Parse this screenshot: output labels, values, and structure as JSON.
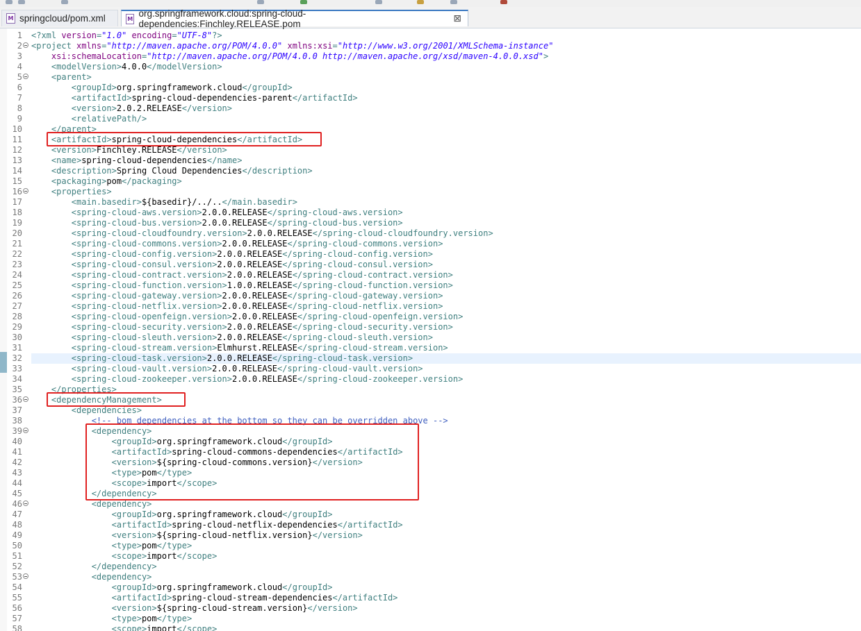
{
  "tabs": [
    {
      "label": "springcloud/pom.xml",
      "icon": "xml-file-icon",
      "active": false
    },
    {
      "label": "org.springframework.cloud:spring-cloud-dependencies:Finchley.RELEASE.pom",
      "icon": "xml-file-icon",
      "active": true,
      "close": "⊠"
    }
  ],
  "editor": {
    "current_line": 32,
    "folded_lines": [
      2,
      5,
      16,
      36,
      39,
      46,
      53
    ],
    "lines": [
      {
        "n": "1",
        "segs": [
          [
            "pi",
            "<?xml "
          ],
          [
            "attr",
            "version"
          ],
          [
            "pi",
            "="
          ],
          [
            "aval",
            "\"1.0\""
          ],
          [
            "pi",
            " "
          ],
          [
            "attr",
            "encoding"
          ],
          [
            "pi",
            "="
          ],
          [
            "aval",
            "\"UTF-8\""
          ],
          [
            "pi",
            "?>"
          ]
        ]
      },
      {
        "n": "2",
        "segs": [
          [
            "tag",
            "<project "
          ],
          [
            "attr",
            "xmlns"
          ],
          [
            "tag",
            "="
          ],
          [
            "aval",
            "\"http://maven.apache.org/POM/4.0.0\""
          ],
          [
            "tag",
            " "
          ],
          [
            "attr",
            "xmlns:xsi"
          ],
          [
            "tag",
            "="
          ],
          [
            "aval",
            "\"http://www.w3.org/2001/XMLSchema-instance\""
          ]
        ]
      },
      {
        "n": "3",
        "segs": [
          [
            "tag",
            "    "
          ],
          [
            "attr",
            "xsi:schemaLocation"
          ],
          [
            "tag",
            "="
          ],
          [
            "aval",
            "\"http://maven.apache.org/POM/4.0.0 http://maven.apache.org/xsd/maven-4.0.0.xsd\""
          ],
          [
            "tag",
            ">"
          ]
        ]
      },
      {
        "n": "4",
        "segs": [
          [
            "tag",
            "    <modelVersion>"
          ],
          [
            "txt",
            "4.0.0"
          ],
          [
            "tag",
            "</modelVersion>"
          ]
        ]
      },
      {
        "n": "5",
        "segs": [
          [
            "tag",
            "    <parent>"
          ]
        ]
      },
      {
        "n": "6",
        "segs": [
          [
            "tag",
            "        <groupId>"
          ],
          [
            "txt",
            "org.springframework.cloud"
          ],
          [
            "tag",
            "</groupId>"
          ]
        ]
      },
      {
        "n": "7",
        "segs": [
          [
            "tag",
            "        <artifactId>"
          ],
          [
            "txt",
            "spring-cloud-dependencies-parent"
          ],
          [
            "tag",
            "</artifactId>"
          ]
        ]
      },
      {
        "n": "8",
        "segs": [
          [
            "tag",
            "        <version>"
          ],
          [
            "txt",
            "2.0.2.RELEASE"
          ],
          [
            "tag",
            "</version>"
          ]
        ]
      },
      {
        "n": "9",
        "segs": [
          [
            "tag",
            "        <relativePath/>"
          ]
        ]
      },
      {
        "n": "10",
        "segs": [
          [
            "tag",
            "    </parent>"
          ]
        ]
      },
      {
        "n": "11",
        "segs": [
          [
            "tag",
            "    <artifactId>"
          ],
          [
            "txt",
            "spring-cloud-dependencies"
          ],
          [
            "tag",
            "</artifactId>"
          ]
        ]
      },
      {
        "n": "12",
        "segs": [
          [
            "tag",
            "    <version>"
          ],
          [
            "txt",
            "Finchley.RELEASE"
          ],
          [
            "tag",
            "</version>"
          ]
        ]
      },
      {
        "n": "13",
        "segs": [
          [
            "tag",
            "    <name>"
          ],
          [
            "txt",
            "spring-cloud-dependencies"
          ],
          [
            "tag",
            "</name>"
          ]
        ]
      },
      {
        "n": "14",
        "segs": [
          [
            "tag",
            "    <description>"
          ],
          [
            "txt",
            "Spring Cloud Dependencies"
          ],
          [
            "tag",
            "</description>"
          ]
        ]
      },
      {
        "n": "15",
        "segs": [
          [
            "tag",
            "    <packaging>"
          ],
          [
            "txt",
            "pom"
          ],
          [
            "tag",
            "</packaging>"
          ]
        ]
      },
      {
        "n": "16",
        "segs": [
          [
            "tag",
            "    <properties>"
          ]
        ]
      },
      {
        "n": "17",
        "segs": [
          [
            "tag",
            "        <main.basedir>"
          ],
          [
            "txt",
            "${basedir}/../.."
          ],
          [
            "tag",
            "</main.basedir>"
          ]
        ]
      },
      {
        "n": "18",
        "segs": [
          [
            "tag",
            "        <spring-cloud-aws.version>"
          ],
          [
            "txt",
            "2.0.0.RELEASE"
          ],
          [
            "tag",
            "</spring-cloud-aws.version>"
          ]
        ]
      },
      {
        "n": "19",
        "segs": [
          [
            "tag",
            "        <spring-cloud-bus.version>"
          ],
          [
            "txt",
            "2.0.0.RELEASE"
          ],
          [
            "tag",
            "</spring-cloud-bus.version>"
          ]
        ]
      },
      {
        "n": "20",
        "segs": [
          [
            "tag",
            "        <spring-cloud-cloudfoundry.version>"
          ],
          [
            "txt",
            "2.0.0.RELEASE"
          ],
          [
            "tag",
            "</spring-cloud-cloudfoundry.version>"
          ]
        ]
      },
      {
        "n": "21",
        "segs": [
          [
            "tag",
            "        <spring-cloud-commons.version>"
          ],
          [
            "txt",
            "2.0.0.RELEASE"
          ],
          [
            "tag",
            "</spring-cloud-commons.version>"
          ]
        ]
      },
      {
        "n": "22",
        "segs": [
          [
            "tag",
            "        <spring-cloud-config.version>"
          ],
          [
            "txt",
            "2.0.0.RELEASE"
          ],
          [
            "tag",
            "</spring-cloud-config.version>"
          ]
        ]
      },
      {
        "n": "23",
        "segs": [
          [
            "tag",
            "        <spring-cloud-consul.version>"
          ],
          [
            "txt",
            "2.0.0.RELEASE"
          ],
          [
            "tag",
            "</spring-cloud-consul.version>"
          ]
        ]
      },
      {
        "n": "24",
        "segs": [
          [
            "tag",
            "        <spring-cloud-contract.version>"
          ],
          [
            "txt",
            "2.0.0.RELEASE"
          ],
          [
            "tag",
            "</spring-cloud-contract.version>"
          ]
        ]
      },
      {
        "n": "25",
        "segs": [
          [
            "tag",
            "        <spring-cloud-function.version>"
          ],
          [
            "txt",
            "1.0.0.RELEASE"
          ],
          [
            "tag",
            "</spring-cloud-function.version>"
          ]
        ]
      },
      {
        "n": "26",
        "segs": [
          [
            "tag",
            "        <spring-cloud-gateway.version>"
          ],
          [
            "txt",
            "2.0.0.RELEASE"
          ],
          [
            "tag",
            "</spring-cloud-gateway.version>"
          ]
        ]
      },
      {
        "n": "27",
        "segs": [
          [
            "tag",
            "        <spring-cloud-netflix.version>"
          ],
          [
            "txt",
            "2.0.0.RELEASE"
          ],
          [
            "tag",
            "</spring-cloud-netflix.version>"
          ]
        ]
      },
      {
        "n": "28",
        "segs": [
          [
            "tag",
            "        <spring-cloud-openfeign.version>"
          ],
          [
            "txt",
            "2.0.0.RELEASE"
          ],
          [
            "tag",
            "</spring-cloud-openfeign.version>"
          ]
        ]
      },
      {
        "n": "29",
        "segs": [
          [
            "tag",
            "        <spring-cloud-security.version>"
          ],
          [
            "txt",
            "2.0.0.RELEASE"
          ],
          [
            "tag",
            "</spring-cloud-security.version>"
          ]
        ]
      },
      {
        "n": "30",
        "segs": [
          [
            "tag",
            "        <spring-cloud-sleuth.version>"
          ],
          [
            "txt",
            "2.0.0.RELEASE"
          ],
          [
            "tag",
            "</spring-cloud-sleuth.version>"
          ]
        ]
      },
      {
        "n": "31",
        "segs": [
          [
            "tag",
            "        <spring-cloud-stream.version>"
          ],
          [
            "txt",
            "Elmhurst.RELEASE"
          ],
          [
            "tag",
            "</spring-cloud-stream.version>"
          ]
        ]
      },
      {
        "n": "32",
        "segs": [
          [
            "tag",
            "        <spring-cloud-task.version>"
          ],
          [
            "txt",
            "2.0.0.RELEASE"
          ],
          [
            "tag",
            "</spring-cloud-task.version>"
          ]
        ]
      },
      {
        "n": "33",
        "segs": [
          [
            "tag",
            "        <spring-cloud-vault.version>"
          ],
          [
            "txt",
            "2.0.0.RELEASE"
          ],
          [
            "tag",
            "</spring-cloud-vault.version>"
          ]
        ]
      },
      {
        "n": "34",
        "segs": [
          [
            "tag",
            "        <spring-cloud-zookeeper.version>"
          ],
          [
            "txt",
            "2.0.0.RELEASE"
          ],
          [
            "tag",
            "</spring-cloud-zookeeper.version>"
          ]
        ]
      },
      {
        "n": "35",
        "segs": [
          [
            "tag",
            "    </properties>"
          ]
        ]
      },
      {
        "n": "36",
        "segs": [
          [
            "tag",
            "    <dependencyManagement>"
          ]
        ]
      },
      {
        "n": "37",
        "segs": [
          [
            "tag",
            "        <dependencies>"
          ]
        ]
      },
      {
        "n": "38",
        "segs": [
          [
            "comment",
            "            <!-- bom dependencies at the bottom so they can be overridden above -->"
          ]
        ]
      },
      {
        "n": "39",
        "segs": [
          [
            "tag",
            "            <dependency>"
          ]
        ]
      },
      {
        "n": "40",
        "segs": [
          [
            "tag",
            "                <groupId>"
          ],
          [
            "txt",
            "org.springframework.cloud"
          ],
          [
            "tag",
            "</groupId>"
          ]
        ]
      },
      {
        "n": "41",
        "segs": [
          [
            "tag",
            "                <artifactId>"
          ],
          [
            "txt",
            "spring-cloud-commons-dependencies"
          ],
          [
            "tag",
            "</artifactId>"
          ]
        ]
      },
      {
        "n": "42",
        "segs": [
          [
            "tag",
            "                <version>"
          ],
          [
            "txt",
            "${spring-cloud-commons.version}"
          ],
          [
            "tag",
            "</version>"
          ]
        ]
      },
      {
        "n": "43",
        "segs": [
          [
            "tag",
            "                <type>"
          ],
          [
            "txt",
            "pom"
          ],
          [
            "tag",
            "</type>"
          ]
        ]
      },
      {
        "n": "44",
        "segs": [
          [
            "tag",
            "                <scope>"
          ],
          [
            "txt",
            "import"
          ],
          [
            "tag",
            "</scope>"
          ]
        ]
      },
      {
        "n": "45",
        "segs": [
          [
            "tag",
            "            </dependency>"
          ]
        ]
      },
      {
        "n": "46",
        "segs": [
          [
            "tag",
            "            <dependency>"
          ]
        ]
      },
      {
        "n": "47",
        "segs": [
          [
            "tag",
            "                <groupId>"
          ],
          [
            "txt",
            "org.springframework.cloud"
          ],
          [
            "tag",
            "</groupId>"
          ]
        ]
      },
      {
        "n": "48",
        "segs": [
          [
            "tag",
            "                <artifactId>"
          ],
          [
            "txt",
            "spring-cloud-netflix-dependencies"
          ],
          [
            "tag",
            "</artifactId>"
          ]
        ]
      },
      {
        "n": "49",
        "segs": [
          [
            "tag",
            "                <version>"
          ],
          [
            "txt",
            "${spring-cloud-netflix.version}"
          ],
          [
            "tag",
            "</version>"
          ]
        ]
      },
      {
        "n": "50",
        "segs": [
          [
            "tag",
            "                <type>"
          ],
          [
            "txt",
            "pom"
          ],
          [
            "tag",
            "</type>"
          ]
        ]
      },
      {
        "n": "51",
        "segs": [
          [
            "tag",
            "                <scope>"
          ],
          [
            "txt",
            "import"
          ],
          [
            "tag",
            "</scope>"
          ]
        ]
      },
      {
        "n": "52",
        "segs": [
          [
            "tag",
            "            </dependency>"
          ]
        ]
      },
      {
        "n": "53",
        "segs": [
          [
            "tag",
            "            <dependency>"
          ]
        ]
      },
      {
        "n": "54",
        "segs": [
          [
            "tag",
            "                <groupId>"
          ],
          [
            "txt",
            "org.springframework.cloud"
          ],
          [
            "tag",
            "</groupId>"
          ]
        ]
      },
      {
        "n": "55",
        "segs": [
          [
            "tag",
            "                <artifactId>"
          ],
          [
            "txt",
            "spring-cloud-stream-dependencies"
          ],
          [
            "tag",
            "</artifactId>"
          ]
        ]
      },
      {
        "n": "56",
        "segs": [
          [
            "tag",
            "                <version>"
          ],
          [
            "txt",
            "${spring-cloud-stream.version}"
          ],
          [
            "tag",
            "</version>"
          ]
        ]
      },
      {
        "n": "57",
        "segs": [
          [
            "tag",
            "                <type>"
          ],
          [
            "txt",
            "pom"
          ],
          [
            "tag",
            "</type>"
          ]
        ]
      },
      {
        "n": "58",
        "segs": [
          [
            "tag",
            "                <scope>"
          ],
          [
            "txt",
            "import"
          ],
          [
            "tag",
            "</scope>"
          ]
        ]
      }
    ]
  },
  "annotations": {
    "color": "#e02020",
    "boxes": [
      {
        "name": "highlight-artifactid",
        "from_line": 11,
        "to_line": 11
      },
      {
        "name": "highlight-dependency-management",
        "from_line": 36,
        "to_line": 36
      },
      {
        "name": "highlight-commons-dependency",
        "from_line": 39,
        "to_line": 45
      }
    ]
  }
}
